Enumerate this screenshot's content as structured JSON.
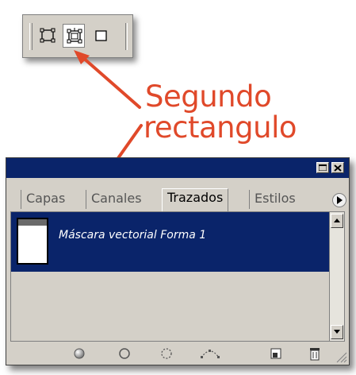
{
  "toolbar": {
    "buttons": [
      {
        "name": "new-shape-layer",
        "icon": "new-shape-layer-icon",
        "pressed": false
      },
      {
        "name": "shape-layer-vector-mask",
        "icon": "vector-mask-icon",
        "pressed": true
      },
      {
        "name": "fill-pixels",
        "icon": "fill-pixels-icon",
        "pressed": false
      }
    ]
  },
  "annotation": {
    "line1": "Segundo",
    "line2": "rectangulo",
    "color": "#e0492a"
  },
  "panel": {
    "title_color": "#0a246a",
    "window_buttons": [
      "minimize-icon",
      "close-icon"
    ],
    "tabs": [
      {
        "label": "Capas",
        "active": false
      },
      {
        "label": "Canales",
        "active": false
      },
      {
        "label": "Trazados",
        "active": true
      },
      {
        "label": "Estilos",
        "active": false
      }
    ],
    "paths": [
      {
        "label": "Máscara vectorial Forma 1",
        "selected": true
      }
    ],
    "footer_icons": [
      "fill-path-icon",
      "stroke-path-icon",
      "load-path-as-selection-icon",
      "make-work-path-icon",
      "new-path-icon",
      "delete-path-icon"
    ]
  }
}
